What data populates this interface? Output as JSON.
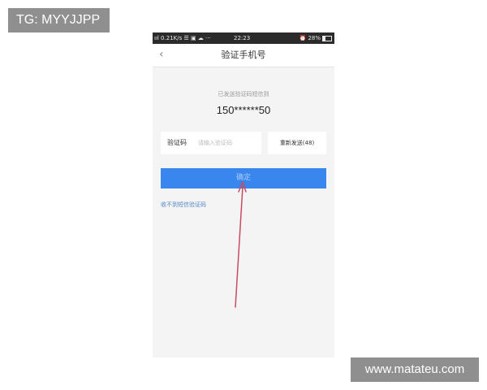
{
  "watermarks": {
    "top_left": "TG: MYYJJPP",
    "bottom_right": "www.matateu.com"
  },
  "statusbar": {
    "left": "ııl 0.21K/s ☰ ▣ ☁ ···",
    "time": "22:23",
    "battery": "⏰ 28%"
  },
  "navbar": {
    "back_icon": "chevron-left-icon",
    "title": "验证手机号"
  },
  "main": {
    "sent_notice": "已发送验证码短信到",
    "phone_number": "150******50",
    "code_label": "验证码",
    "code_placeholder": "请输入验证码",
    "code_value": "",
    "resend_label": "重新发送(48)",
    "confirm_label": "确定",
    "no_sms_link": "收不到短信验证码"
  },
  "colors": {
    "primary": "#3a86ef",
    "link": "#4f86c9",
    "annotation_arrow": "#c84a5e"
  }
}
